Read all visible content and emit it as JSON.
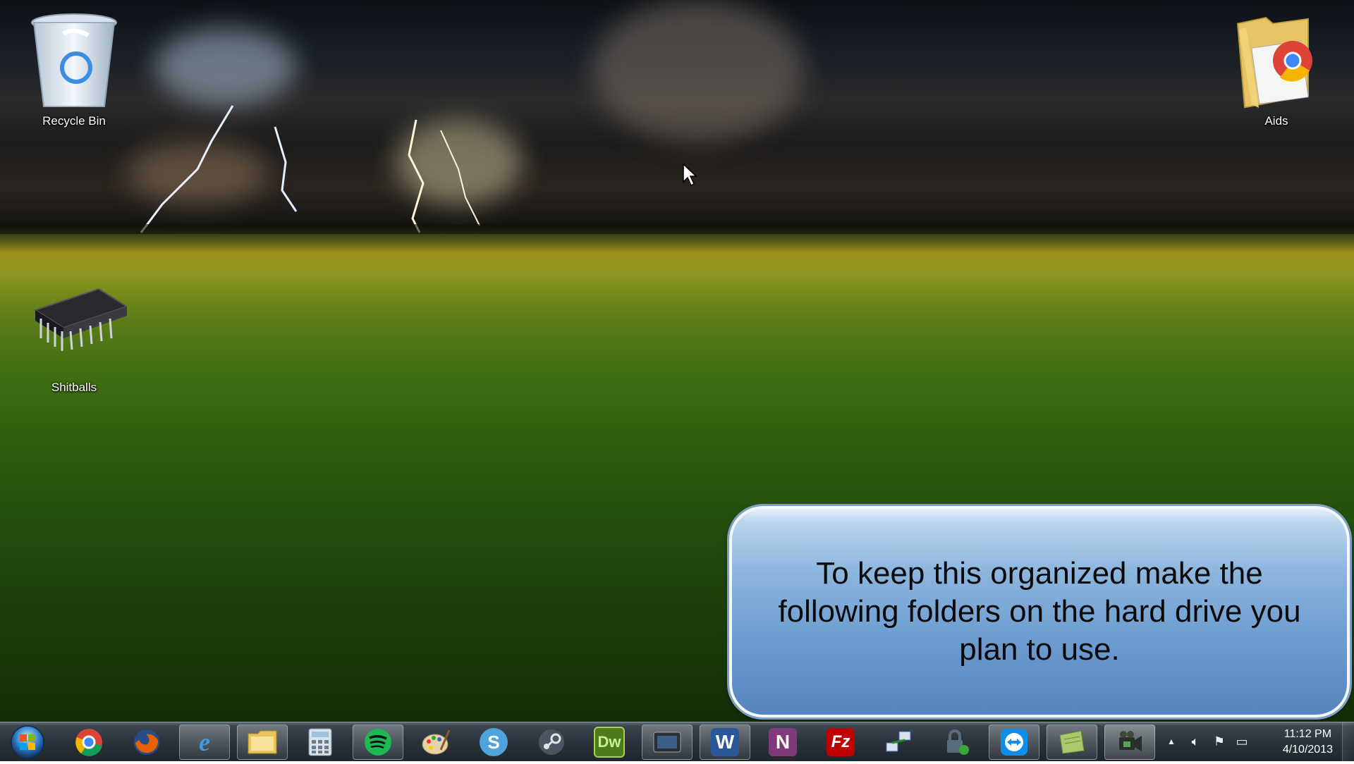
{
  "desktop": {
    "icons": [
      {
        "label": "Recycle Bin",
        "icon": "recycle-bin-icon"
      },
      {
        "label": "Shitballs",
        "icon": "chip-icon"
      },
      {
        "label": "Aids",
        "icon": "folder-chrome-icon"
      }
    ]
  },
  "callout": {
    "text": "To keep this organized make the following folders on the hard drive you plan to use."
  },
  "taskbar": {
    "start_icon": "windows-start-orb",
    "apps": [
      {
        "icon": "chrome-icon",
        "color": "#db4437"
      },
      {
        "icon": "firefox-icon",
        "color": "#e66000"
      },
      {
        "icon": "internet-explorer-icon",
        "color": "#1e88e5"
      },
      {
        "icon": "windows-explorer-icon",
        "color": "#e8c45a"
      },
      {
        "icon": "calculator-icon",
        "color": "#9fb4c8"
      },
      {
        "icon": "spotify-icon",
        "color": "#1db954"
      },
      {
        "icon": "paint-icon",
        "color": "#c8a060"
      },
      {
        "icon": "skype-icon",
        "color": "#4fa3dc"
      },
      {
        "icon": "steam-icon",
        "color": "#4a5561"
      },
      {
        "icon": "dreamweaver-icon",
        "color": "#4f7a1c",
        "text": "Dw"
      },
      {
        "icon": "video-app-icon",
        "color": "#2b2f36"
      },
      {
        "icon": "word-icon",
        "color": "#2b579a",
        "text": "W"
      },
      {
        "icon": "onenote-icon",
        "color": "#80397b",
        "text": "N"
      },
      {
        "icon": "filezilla-icon",
        "color": "#bf0000",
        "text": "Fz"
      },
      {
        "icon": "network-tool-icon",
        "color": "#3b6fb6"
      },
      {
        "icon": "security-lock-icon",
        "color": "#5a6b7a"
      },
      {
        "icon": "teamviewer-icon",
        "color": "#0e8ee9"
      },
      {
        "icon": "notes-icon",
        "color": "#a9c96a"
      },
      {
        "icon": "camera-recorder-icon",
        "color": "#3a4a3a"
      }
    ],
    "tray": {
      "icons": [
        "show-hidden-icons",
        "volume-icon",
        "action-center-flag-icon",
        "network-icon"
      ],
      "time": "11:12 PM",
      "date": "4/10/2013"
    }
  }
}
